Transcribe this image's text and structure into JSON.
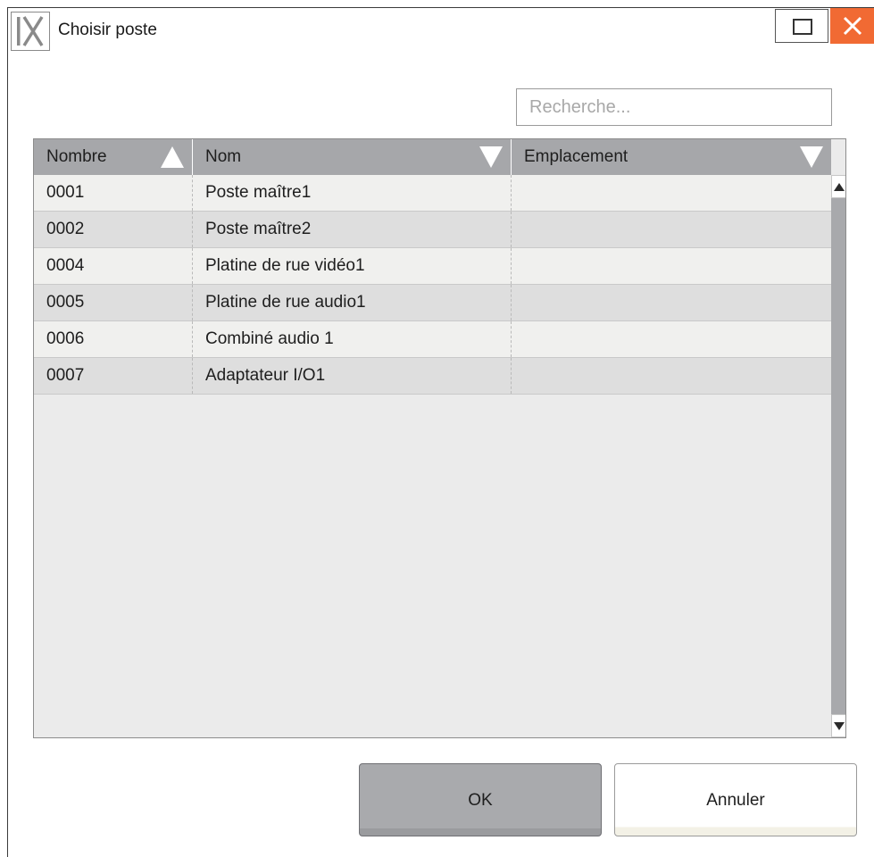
{
  "window": {
    "title": "Choisir poste",
    "logo_icon": "app-logo-ix",
    "maximize_icon": "maximize-icon",
    "close_icon": "close-icon",
    "close_color": "#f16a33"
  },
  "search": {
    "placeholder": "Recherche..."
  },
  "table": {
    "columns": [
      {
        "label": "Nombre",
        "sort": "ascending",
        "icon": "sort-up-icon"
      },
      {
        "label": "Nom",
        "sort": "descending",
        "icon": "sort-down-icon"
      },
      {
        "label": "Emplacement",
        "sort": "descending",
        "icon": "sort-down-icon"
      }
    ],
    "rows": [
      [
        "0001",
        "Poste maître1",
        ""
      ],
      [
        "0002",
        "Poste maître2",
        ""
      ],
      [
        "0004",
        "Platine de rue vidéo1",
        ""
      ],
      [
        "0005",
        "Platine de rue audio1",
        ""
      ],
      [
        "0006",
        "Combiné audio 1",
        ""
      ],
      [
        "0007",
        "Adaptateur I/O1",
        ""
      ]
    ],
    "scroll_up_icon": "scroll-up-arrow-icon",
    "scroll_down_icon": "scroll-down-arrow-icon"
  },
  "buttons": {
    "ok_label": "OK",
    "cancel_label": "Annuler"
  }
}
